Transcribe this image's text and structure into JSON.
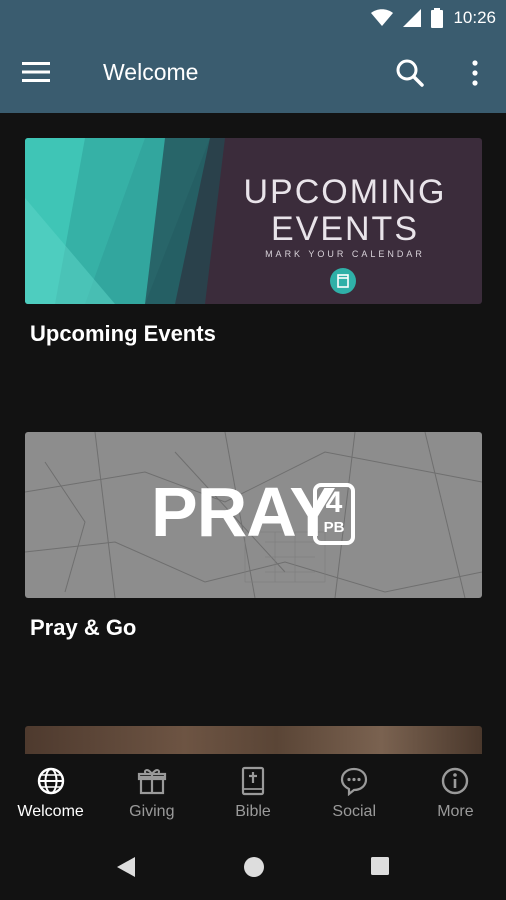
{
  "status_bar": {
    "time": "10:26"
  },
  "app_bar": {
    "title": "Welcome"
  },
  "cards": [
    {
      "title": "Upcoming Events",
      "image": {
        "line1": "UPCOMING",
        "line2": "EVENTS",
        "subtitle": "MARK YOUR CALENDAR"
      }
    },
    {
      "title": "Pray & Go",
      "image": {
        "word": "PRAY",
        "badge_num": "4",
        "badge_text": "PB"
      }
    }
  ],
  "bottom_nav": {
    "items": [
      {
        "label": "Welcome",
        "icon": "globe-icon",
        "active": true
      },
      {
        "label": "Giving",
        "icon": "gift-icon"
      },
      {
        "label": "Bible",
        "icon": "bible-icon"
      },
      {
        "label": "Social",
        "icon": "chat-icon"
      },
      {
        "label": "More",
        "icon": "info-icon"
      }
    ]
  },
  "colors": {
    "app_bar": "#3a5c6f",
    "background": "#121212",
    "teal_accent": "#2fb0a8"
  }
}
